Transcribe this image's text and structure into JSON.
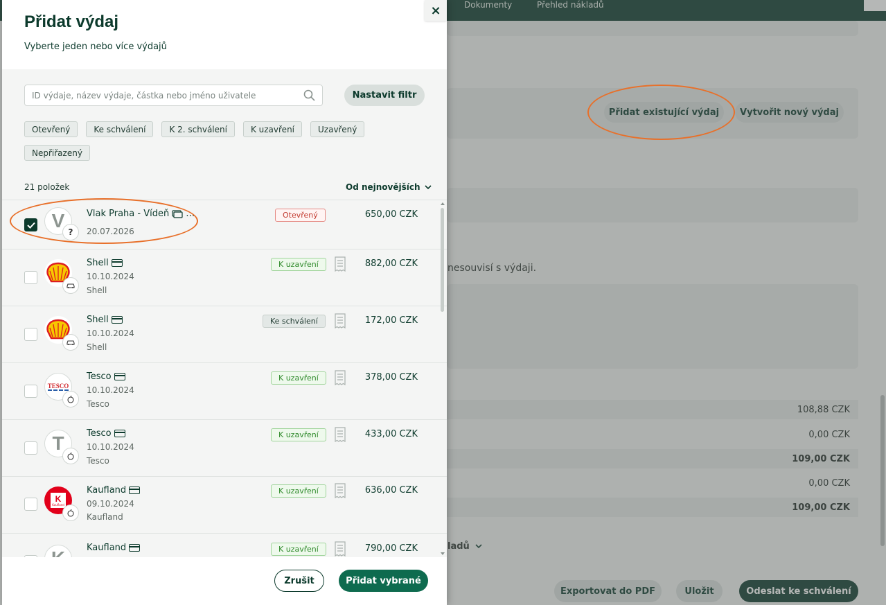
{
  "background": {
    "nav": [
      "Dokumenty",
      "Přehled nákladů"
    ],
    "buttons": {
      "add_existing": "Přidat existující výdaj",
      "create_new": "Vytvořit nový výdaj"
    },
    "notice_text": "nesouvisí s výdaji.",
    "summary_rows": [
      "108,88 CZK",
      "0,00 CZK",
      "109,00 CZK",
      "0,00 CZK",
      "109,00 CZK"
    ],
    "costs_toggle": "ladů",
    "footer": {
      "export": "Exportovat do PDF",
      "save": "Uložit",
      "submit": "Odeslat ke schválení"
    }
  },
  "modal": {
    "title": "Přidat výdaj",
    "subtitle": "Vyberte jeden nebo více výdajů",
    "close": "×",
    "search_placeholder": "ID výdaje, název výdaje, částka nebo jméno uživatele",
    "filter_button": "Nastavit filtr",
    "chips": [
      "Otevřený",
      "Ke schválení",
      "K 2. schválení",
      "K uzavření",
      "Uzavřený",
      "Nepřiřazený"
    ],
    "count": "21 položek",
    "sort": "Od nejnovějších",
    "expenses": [
      {
        "title": "Vlak Praha - Vídeň",
        "date": "20.07.2026",
        "merchant": "",
        "status": "Otevřený",
        "amount": "650,00 CZK",
        "avatar": "V",
        "badge": "?",
        "checked": true
      },
      {
        "title": "Shell",
        "date": "10.10.2024",
        "merchant": "Shell",
        "status": "K uzavření",
        "amount": "882,00 CZK",
        "avatar": "shell-logo",
        "badge": "car-icon",
        "checked": false
      },
      {
        "title": "Shell",
        "date": "10.10.2024",
        "merchant": "Shell",
        "status": "Ke schválení",
        "amount": "172,00 CZK",
        "avatar": "shell-logo",
        "badge": "car-icon",
        "checked": false
      },
      {
        "title": "Tesco",
        "date": "10.10.2024",
        "merchant": "Tesco",
        "status": "K uzavření",
        "amount": "378,00 CZK",
        "avatar": "TESCO",
        "badge": "apple-icon",
        "checked": false
      },
      {
        "title": "Tesco",
        "date": "10.10.2024",
        "merchant": "Tesco",
        "status": "K uzavření",
        "amount": "433,00 CZK",
        "avatar": "T",
        "badge": "apple-icon",
        "checked": false
      },
      {
        "title": "Kaufland",
        "date": "09.10.2024",
        "merchant": "Kaufland",
        "status": "K uzavření",
        "amount": "636,00 CZK",
        "avatar": "Kaufland",
        "badge": "apple-icon",
        "checked": false
      },
      {
        "title": "Kaufland",
        "date": "",
        "merchant": "",
        "status": "K uzavření",
        "amount": "790,00 CZK",
        "avatar": "K",
        "badge": "",
        "checked": false
      }
    ],
    "cancel": "Zrušit",
    "add_selected": "Přidat vybrané"
  },
  "colors": {
    "brand_dark": "#0c3a2c",
    "primary": "#0e6b4f",
    "highlight": "#e8702a",
    "status_open": "#c2392f",
    "status_close": "#2f8a2b"
  }
}
